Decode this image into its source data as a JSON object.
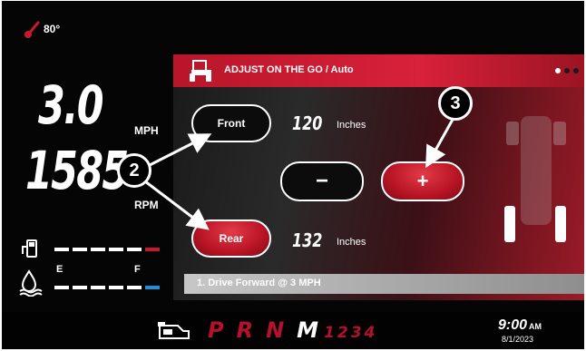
{
  "status": {
    "temperature": "80°"
  },
  "gauges": {
    "speed_value": "3.0",
    "speed_unit": "MPH",
    "rpm_value": "1585",
    "rpm_unit": "RPM",
    "fuel_empty": "E",
    "fuel_full": "F"
  },
  "panel": {
    "title": "ADJUST ON THE GO / Auto",
    "page_indicator": {
      "count": 3,
      "active_index": 0
    },
    "front_label": "Front",
    "front_value": "120",
    "front_unit": "Inches",
    "rear_label": "Rear",
    "rear_value": "132",
    "rear_unit": "Inches",
    "minus_label": "−",
    "plus_label": "+",
    "instruction": "1. Drive Forward @ 3 MPH"
  },
  "transmission": {
    "gears": [
      "P",
      "R",
      "N",
      "M"
    ],
    "active_gear": "M",
    "sub_gears": "1234"
  },
  "clock": {
    "time": "9:00",
    "ampm": "AM",
    "date": "8/1/2023"
  },
  "callouts": {
    "a": "2",
    "b": "3"
  },
  "colors": {
    "accent_red": "#c8182e",
    "background": "#050505"
  }
}
